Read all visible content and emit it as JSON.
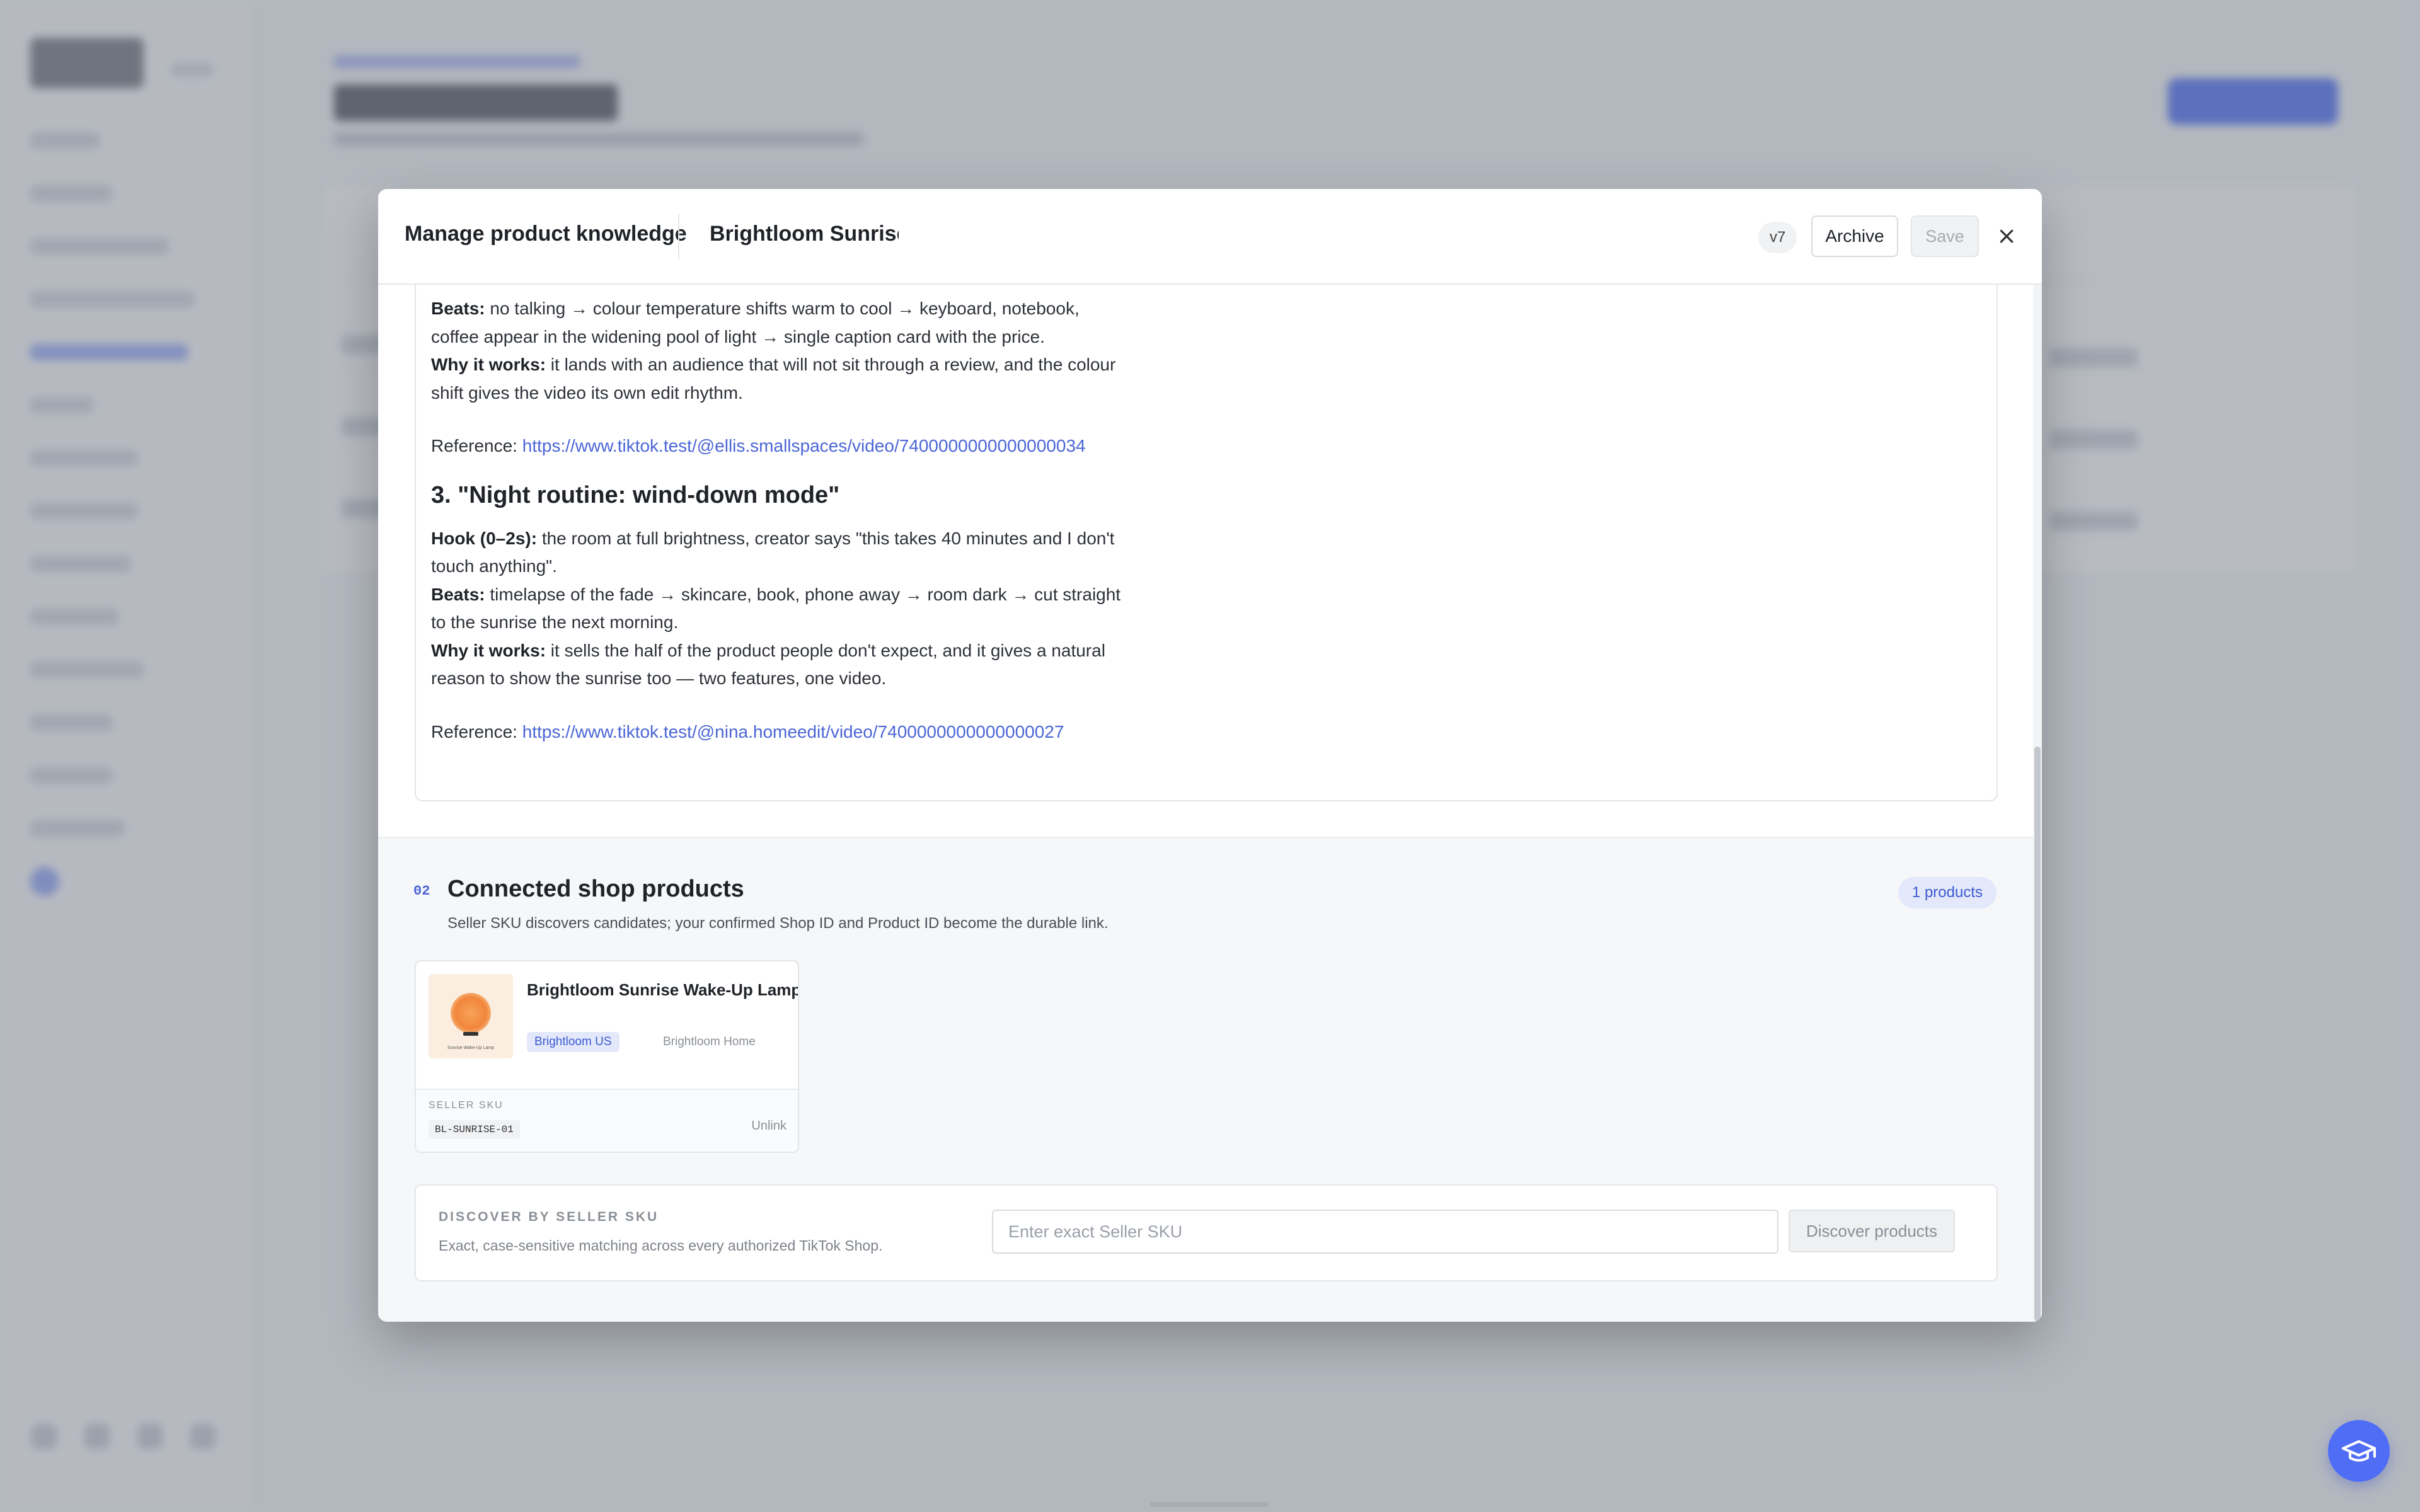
{
  "header": {
    "title": "Manage product knowledge",
    "product_name": "Brightloom Sunrise Wake-Up Lamp",
    "version": "v7",
    "archive_label": "Archive",
    "save_label": "Save",
    "close_symbol": "×"
  },
  "doc": {
    "beats_label": "Beats:",
    "beats_text": "no talking → colour temperature shifts warm to cool → keyboard, notebook, coffee appear in the widening pool of light → single caption card with the price.",
    "why_label": "Why it works:",
    "why_text": "it lands with an audience that will not sit through a review, and the colour shift gives the video its own edit rhythm.",
    "reference_label": "Reference:",
    "reference_url": "https://www.tiktok.test/@ellis.smallspaces/video/7400000000000000034",
    "section3_title": "3. \"Night routine: wind-down mode\"",
    "hook_label": "Hook (0–2s):",
    "hook_text": "the room at full brightness, creator says \"this takes 40 minutes and I don't touch anything\".",
    "beats3_label": "Beats:",
    "beats3_text": "timelapse of the fade → skincare, book, phone away → room dark → cut straight to the sunrise the next morning.",
    "why3_label": "Why it works:",
    "why3_text": "it sells the half of the product people don't expect, and it gives a natural reason to show the sunrise too — two features, one video.",
    "reference3_label": "Reference:",
    "reference3_url": "https://www.tiktok.test/@nina.homeedit/video/7400000000000000027"
  },
  "shop": {
    "section_number": "02",
    "title": "Connected shop products",
    "subtitle": "Seller SKU discovers candidates; your confirmed Shop ID and Product ID become the durable link.",
    "count_badge": "1 products",
    "products": [
      {
        "name": "Brightloom Sunrise Wake-Up Lamp",
        "shop_tag": "Brightloom US",
        "shop_alt": "Brightloom Home",
        "thumb_caption": "Sunrise Wake-Up Lamp",
        "sku_label": "SELLER SKU",
        "sku": "BL-SUNRISE-01",
        "unlink_label": "Unlink"
      }
    ],
    "discover": {
      "label": "DISCOVER BY SELLER SKU",
      "description": "Exact, case-sensitive matching across every authorized TikTok Shop.",
      "placeholder": "Enter exact Seller SKU",
      "button_label": "Discover products"
    }
  },
  "icons": {
    "help": "graduation-cap-icon",
    "close": "close-icon"
  },
  "colors": {
    "accent": "#4f6df5",
    "link": "#4b66d6",
    "scrim": "rgba(107,114,128,0.48)"
  }
}
